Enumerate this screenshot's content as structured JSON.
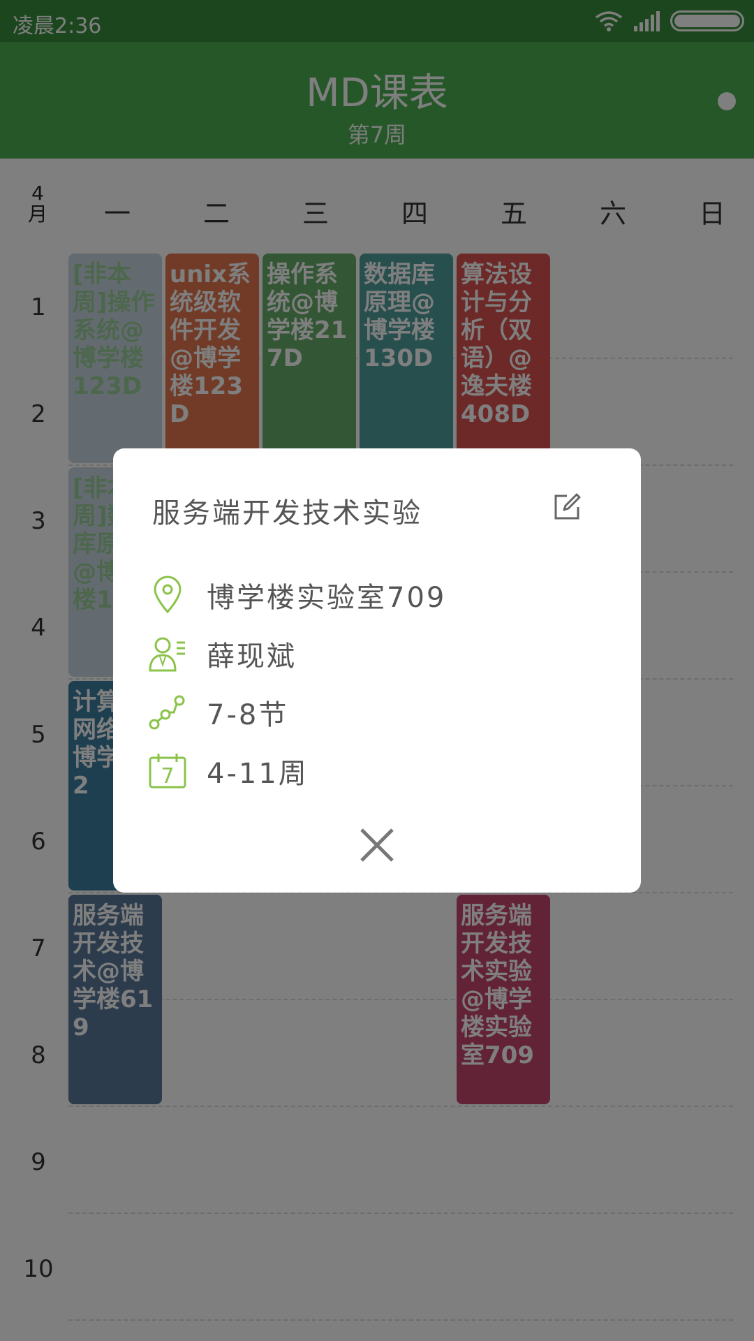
{
  "status_bar": {
    "time": "凌晨2:36"
  },
  "app_bar": {
    "title": "MD课表",
    "subtitle": "第7周"
  },
  "header": {
    "month_num": "4",
    "month_unit": "月",
    "days": [
      "一",
      "二",
      "三",
      "四",
      "五",
      "六",
      "日"
    ]
  },
  "rows": [
    "1",
    "2",
    "3",
    "4",
    "5",
    "6",
    "7",
    "8",
    "9",
    "10"
  ],
  "courses": [
    {
      "text": "[非本周]操作系统@博学楼123D",
      "color": "#c8d6e0",
      "text_color": "#9bcf9b"
    },
    {
      "text": "unix系统级软件开发@博学楼123D",
      "color": "#e2764e"
    },
    {
      "text": "操作系统@博学楼217D",
      "color": "#66ad6a"
    },
    {
      "text": "数据库原理@博学楼130D",
      "color": "#4f9e9c"
    },
    {
      "text": "算法设计与分析（双语）@逸夫楼408D",
      "color": "#d9534f"
    },
    {
      "text": "[非本周]数据库原理@博学楼1",
      "color": "#c8d6e0",
      "text_color": "#9bcf9b"
    },
    {
      "text": "计算机网络@博学楼2",
      "color": "#3d7fa1"
    },
    {
      "text": "服务端开发技术@博学楼619",
      "color": "#587898"
    },
    {
      "text": "服务端开发技术实验@博学楼实验室709",
      "color": "#c7476e"
    }
  ],
  "dialog": {
    "title": "服务端开发技术实验",
    "location": "博学楼实验室709",
    "teacher": "薛现斌",
    "sections": "7-8节",
    "weeks": "4-11周",
    "calendar_icon_day": "7"
  },
  "colors": {
    "primary": "#4caf50",
    "primary_dark": "#388e3c",
    "icon_accent": "#8bc34a"
  }
}
